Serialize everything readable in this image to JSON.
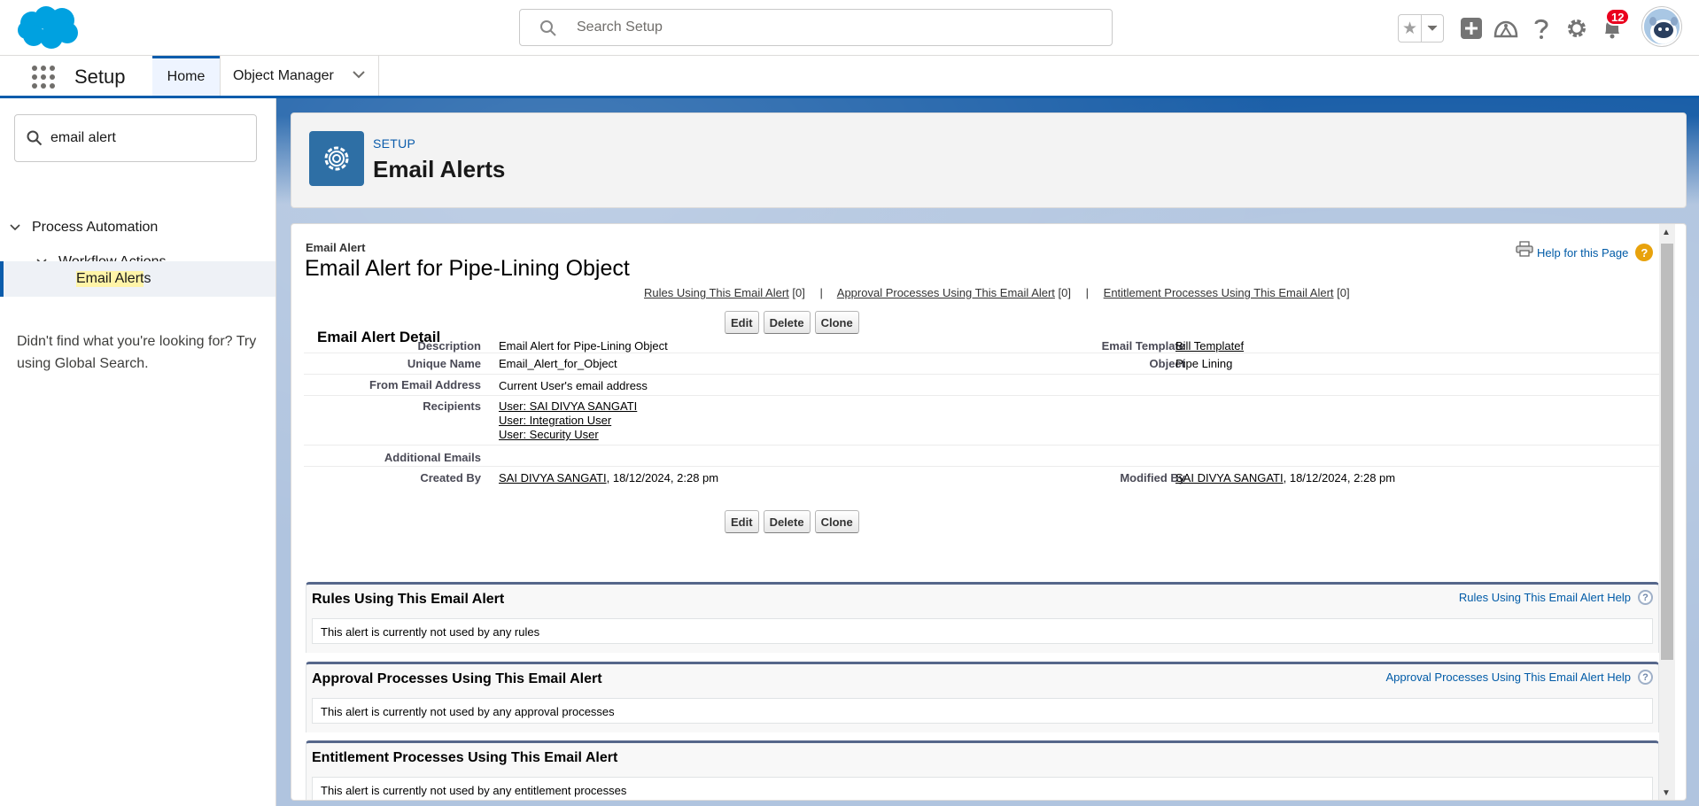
{
  "header": {
    "search_placeholder": "Search Setup",
    "notification_count": "12",
    "icons": [
      "salesforce-logo",
      "search-icon",
      "favorites-star-icon",
      "chevron-down-icon",
      "global-actions-plus-icon",
      "trailhead-icon",
      "help-icon",
      "gear-icon",
      "bell-icon",
      "avatar"
    ]
  },
  "app_nav": {
    "app_name": "Setup",
    "tabs": [
      {
        "label": "Home"
      },
      {
        "label": "Object Manager"
      }
    ]
  },
  "sidebar": {
    "quick_find_value": "email alert",
    "tree": {
      "process_automation": "Process Automation",
      "workflow_actions": "Workflow Actions",
      "email_alerts_highlight": "Email Alert",
      "email_alerts_rest": "s"
    },
    "help_text": "Didn't find what you're looking for? Try using Global Search."
  },
  "page_header": {
    "eyebrow": "SETUP",
    "title": "Email Alerts"
  },
  "record": {
    "type_label": "Email Alert",
    "title": "Email Alert for Pipe-Lining Object",
    "help_link": "Help for this Page",
    "related_links": [
      {
        "label": "Rules Using This Email Alert",
        "count": "[0]"
      },
      {
        "label": "Approval Processes Using This Email Alert",
        "count": "[0]"
      },
      {
        "label": "Entitlement Processes Using This Email Alert",
        "count": "[0]"
      }
    ],
    "related_sep": "|",
    "detail_title": "Email Alert Detail",
    "buttons": {
      "edit": "Edit",
      "delete": "Delete",
      "clone": "Clone"
    },
    "fields": {
      "description_label": "Description",
      "description_value": "Email Alert for Pipe-Lining Object",
      "email_template_label": "Email Template",
      "email_template_value": "Bill Templatef",
      "unique_name_label": "Unique Name",
      "unique_name_value": "Email_Alert_for_Object",
      "object_label": "Object",
      "object_value": "Pipe Lining",
      "from_label": "From Email Address",
      "from_value": "Current User's email address",
      "recipients_label": "Recipients",
      "recipients": [
        "User: SAI DIVYA SANGATI",
        "User: Integration User",
        "User: Security User"
      ],
      "additional_label": "Additional Emails",
      "created_label": "Created By",
      "created_user": "SAI DIVYA SANGATI",
      "created_date": ", 18/12/2024, 2:28 pm",
      "modified_label": "Modified By",
      "modified_user": "SAI DIVYA SANGATI",
      "modified_date": ", 18/12/2024, 2:28 pm"
    },
    "related_lists": [
      {
        "title": "Rules Using This Email Alert",
        "help": "Rules Using This Email Alert Help",
        "message": "This alert is currently not used by any rules"
      },
      {
        "title": "Approval Processes Using This Email Alert",
        "help": "Approval Processes Using This Email Alert Help",
        "message": "This alert is currently not used by any approval processes"
      },
      {
        "title": "Entitlement Processes Using This Email Alert",
        "help": "",
        "message": "This alert is currently not used by any entitlement processes"
      }
    ]
  },
  "colors": {
    "brand_blue": "#0b5cab",
    "cloud_blue": "#00a1e0",
    "badge_red": "#ea001e",
    "setup_icon_bg": "#2e6fa5",
    "related_list_border": "#56678b"
  }
}
